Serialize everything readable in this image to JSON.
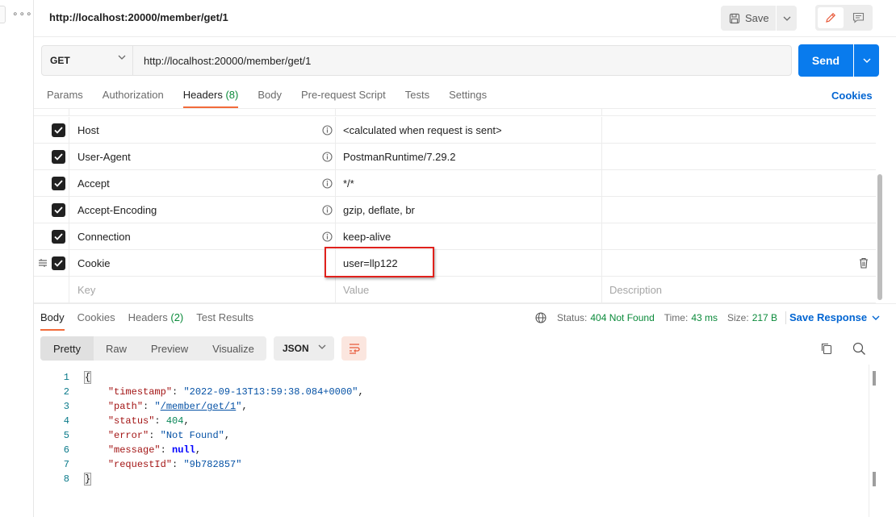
{
  "request": {
    "title": "http://localhost:20000/member/get/1",
    "method": "GET",
    "url": "http://localhost:20000/member/get/1",
    "save_label": "Save",
    "send_label": "Send"
  },
  "request_tabs": [
    {
      "label": "Params",
      "count": ""
    },
    {
      "label": "Authorization",
      "count": ""
    },
    {
      "label": "Headers",
      "count": "(8)"
    },
    {
      "label": "Body",
      "count": ""
    },
    {
      "label": "Pre-request Script",
      "count": ""
    },
    {
      "label": "Tests",
      "count": ""
    },
    {
      "label": "Settings",
      "count": ""
    }
  ],
  "cookies_link": "Cookies",
  "headers": [
    {
      "key": "Host",
      "value": "<calculated when request is sent>",
      "checked": true
    },
    {
      "key": "User-Agent",
      "value": "PostmanRuntime/7.29.2",
      "checked": true
    },
    {
      "key": "Accept",
      "value": "*/*",
      "checked": true
    },
    {
      "key": "Accept-Encoding",
      "value": "gzip, deflate, br",
      "checked": true
    },
    {
      "key": "Connection",
      "value": "keep-alive",
      "checked": true
    },
    {
      "key": "Cookie",
      "value": "user=llp122",
      "checked": true
    }
  ],
  "header_placeholders": {
    "key": "Key",
    "value": "Value",
    "description": "Description"
  },
  "response": {
    "tabs": [
      {
        "label": "Body",
        "count": ""
      },
      {
        "label": "Cookies",
        "count": ""
      },
      {
        "label": "Headers",
        "count": "(2)"
      },
      {
        "label": "Test Results",
        "count": ""
      }
    ],
    "status_label": "Status:",
    "status_value": "404 Not Found",
    "time_label": "Time:",
    "time_value": "43 ms",
    "size_label": "Size:",
    "size_value": "217 B",
    "save_response": "Save Response",
    "view_modes": [
      "Pretty",
      "Raw",
      "Preview",
      "Visualize"
    ],
    "format": "JSON",
    "code_lines": [
      {
        "n": "1",
        "tokens": [
          {
            "t": "{",
            "c": "bracket"
          }
        ]
      },
      {
        "n": "2",
        "tokens": [
          {
            "t": "    "
          },
          {
            "t": "\"timestamp\"",
            "c": "k"
          },
          {
            "t": ": "
          },
          {
            "t": "\"2022-09-13T13:59:38.084+0000\"",
            "c": "s"
          },
          {
            "t": ","
          }
        ]
      },
      {
        "n": "3",
        "tokens": [
          {
            "t": "    "
          },
          {
            "t": "\"path\"",
            "c": "k"
          },
          {
            "t": ": "
          },
          {
            "t": "\"",
            "c": "s"
          },
          {
            "t": "/member/get/1",
            "c": "s u"
          },
          {
            "t": "\"",
            "c": "s"
          },
          {
            "t": ","
          }
        ]
      },
      {
        "n": "4",
        "tokens": [
          {
            "t": "    "
          },
          {
            "t": "\"status\"",
            "c": "k"
          },
          {
            "t": ": "
          },
          {
            "t": "404",
            "c": "n"
          },
          {
            "t": ","
          }
        ]
      },
      {
        "n": "5",
        "tokens": [
          {
            "t": "    "
          },
          {
            "t": "\"error\"",
            "c": "k"
          },
          {
            "t": ": "
          },
          {
            "t": "\"Not Found\"",
            "c": "s"
          },
          {
            "t": ","
          }
        ]
      },
      {
        "n": "6",
        "tokens": [
          {
            "t": "    "
          },
          {
            "t": "\"message\"",
            "c": "k"
          },
          {
            "t": ": "
          },
          {
            "t": "null",
            "c": "b"
          },
          {
            "t": ","
          }
        ]
      },
      {
        "n": "7",
        "tokens": [
          {
            "t": "    "
          },
          {
            "t": "\"requestId\"",
            "c": "k"
          },
          {
            "t": ": "
          },
          {
            "t": "\"9b782857\"",
            "c": "s"
          }
        ]
      },
      {
        "n": "8",
        "tokens": [
          {
            "t": "}",
            "c": "bracket"
          }
        ]
      }
    ]
  },
  "colors": {
    "accent_orange": "#f26b3a",
    "send_blue": "#097bed",
    "link_blue": "#0265d2",
    "status_green": "#0a8a3a",
    "highlight_red": "#e0211c"
  }
}
